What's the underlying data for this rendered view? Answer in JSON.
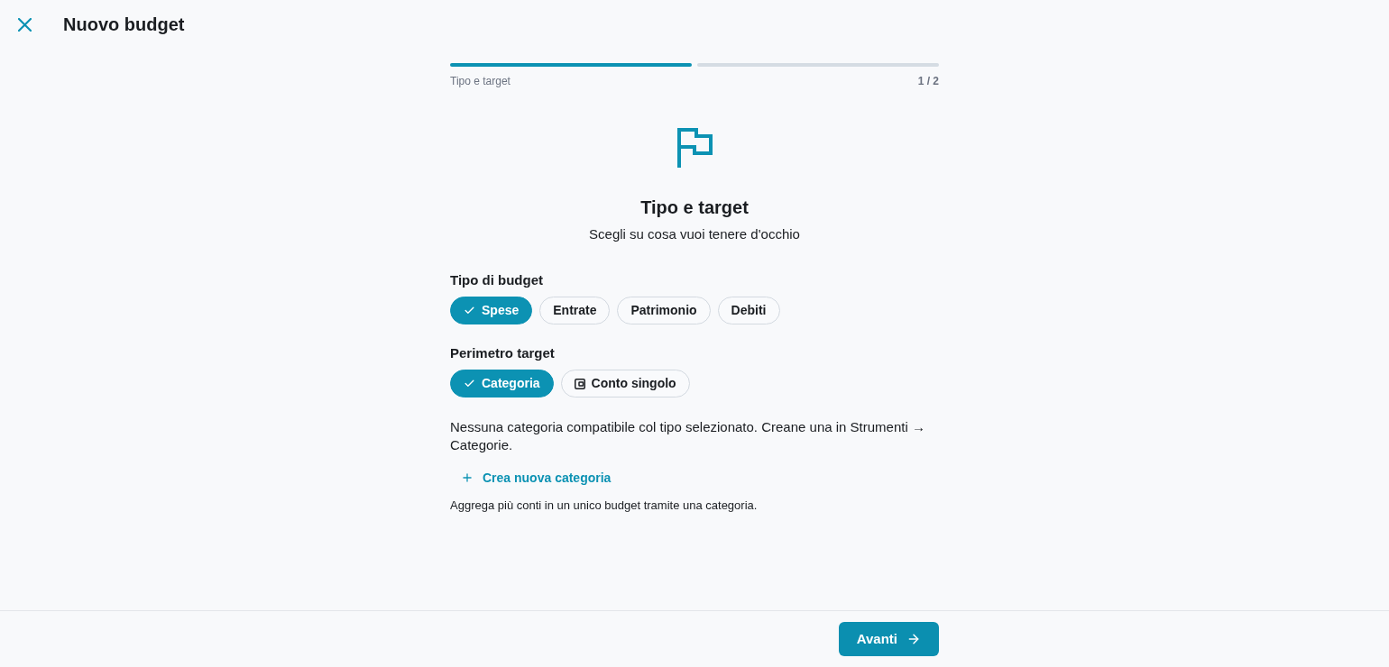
{
  "header": {
    "title": "Nuovo budget"
  },
  "progress": {
    "segments": [
      {
        "completed": true
      },
      {
        "completed": false
      }
    ],
    "step_label": "Tipo e target",
    "step_count": "1 / 2"
  },
  "intro": {
    "title": "Tipo e target",
    "subtitle": "Scegli su cosa vuoi tenere d'occhio"
  },
  "budget_type": {
    "label": "Tipo di budget",
    "options": [
      {
        "label": "Spese",
        "selected": true
      },
      {
        "label": "Entrate",
        "selected": false
      },
      {
        "label": "Patrimonio",
        "selected": false
      },
      {
        "label": "Debiti",
        "selected": false
      }
    ]
  },
  "target_scope": {
    "label": "Perimetro target",
    "options": [
      {
        "label": "Categoria",
        "selected": true
      },
      {
        "label": "Conto singolo",
        "selected": false,
        "kind": "account"
      }
    ]
  },
  "notice": "Nessuna categoria compatibile col tipo selezionato. Creane una in Strumenti → Categorie.",
  "create_link": "Crea nuova categoria",
  "hint": "Aggrega più conti in un unico budget tramite una categoria.",
  "footer": {
    "next_button": "Avanti"
  }
}
